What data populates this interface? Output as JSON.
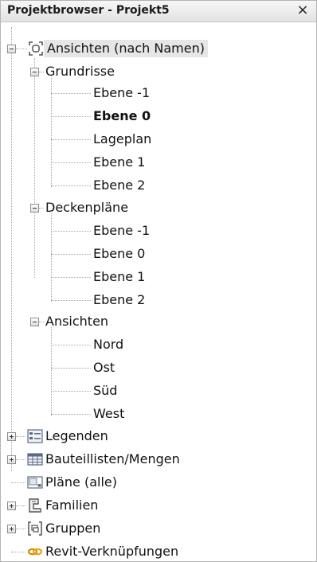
{
  "title": "Projektbrowser - Projekt5",
  "close_glyph": "×",
  "tree": {
    "root": "Ansichten (nach Namen)",
    "grundrisse": {
      "label": "Grundrisse",
      "items": [
        "Ebene -1",
        "Ebene 0",
        "Lageplan",
        "Ebene 1",
        "Ebene 2"
      ],
      "bold_item": "Ebene 0"
    },
    "deckenplaene": {
      "label": "Deckenpläne",
      "items": [
        "Ebene -1",
        "Ebene 0",
        "Ebene 1",
        "Ebene 2"
      ]
    },
    "ansichten": {
      "label": "Ansichten",
      "items": [
        "Nord",
        "Ost",
        "Süd",
        "West"
      ]
    },
    "others": [
      "Legenden",
      "Bauteillisten/Mengen",
      "Pläne (alle)",
      "Familien",
      "Gruppen",
      "Revit-Verknüpfungen"
    ]
  },
  "icons": {
    "root": "view-frame-icon",
    "others": [
      "legend-icon",
      "schedule-icon",
      "sheet-icon",
      "family-icon",
      "group-icon",
      "revit-link-icon"
    ]
  }
}
